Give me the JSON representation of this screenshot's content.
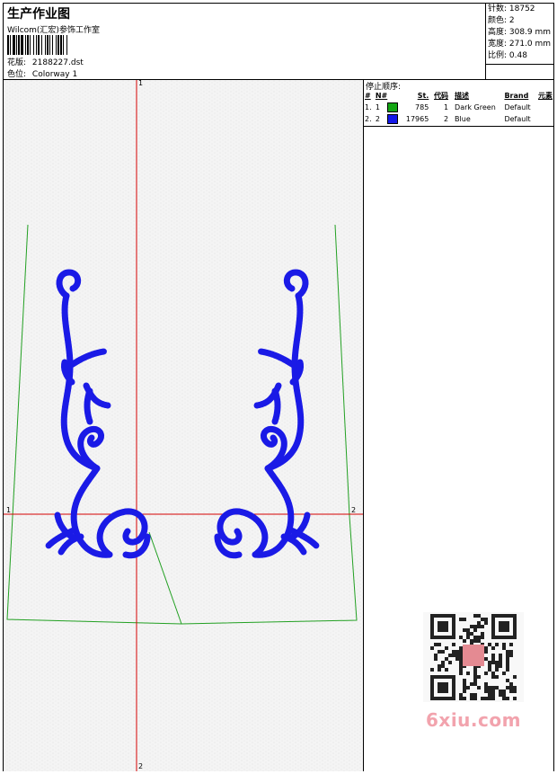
{
  "header": {
    "title": "生产作业图",
    "subtitle": "Wilcom(汇宏)参饰工作室",
    "pattern_label": "花版:",
    "pattern_value": "2188227.dst",
    "colorway_label": "色位:",
    "colorway_value": "Colorway 1"
  },
  "stats": {
    "stitches": "针数: 18752",
    "colors": "颜色: 2",
    "height": "高度: 308.9 mm",
    "width": "宽度: 271.0 mm",
    "scale": "比例: 0.48"
  },
  "stops": {
    "title": "停止顺序:",
    "headers": [
      "#",
      "N#",
      "St.",
      "代码",
      "描述",
      "Brand",
      "元素"
    ],
    "rows": [
      {
        "idx": "1.",
        "n": "1",
        "swatch": "#13a613",
        "st": "785",
        "code": "1",
        "desc": "Dark Green",
        "brand": "Default",
        "elem": ""
      },
      {
        "idx": "2.",
        "n": "2",
        "swatch": "#1418e8",
        "st": "17965",
        "code": "2",
        "desc": "Blue",
        "brand": "Default",
        "elem": ""
      }
    ]
  },
  "axes": {
    "top": "1",
    "bottom": "2",
    "left": "1",
    "right": "2"
  },
  "watermark": "6xiu.com",
  "colors": {
    "outline": "#22a022",
    "embroidery": "#1a1ae6",
    "crosshair": "#d40000"
  }
}
